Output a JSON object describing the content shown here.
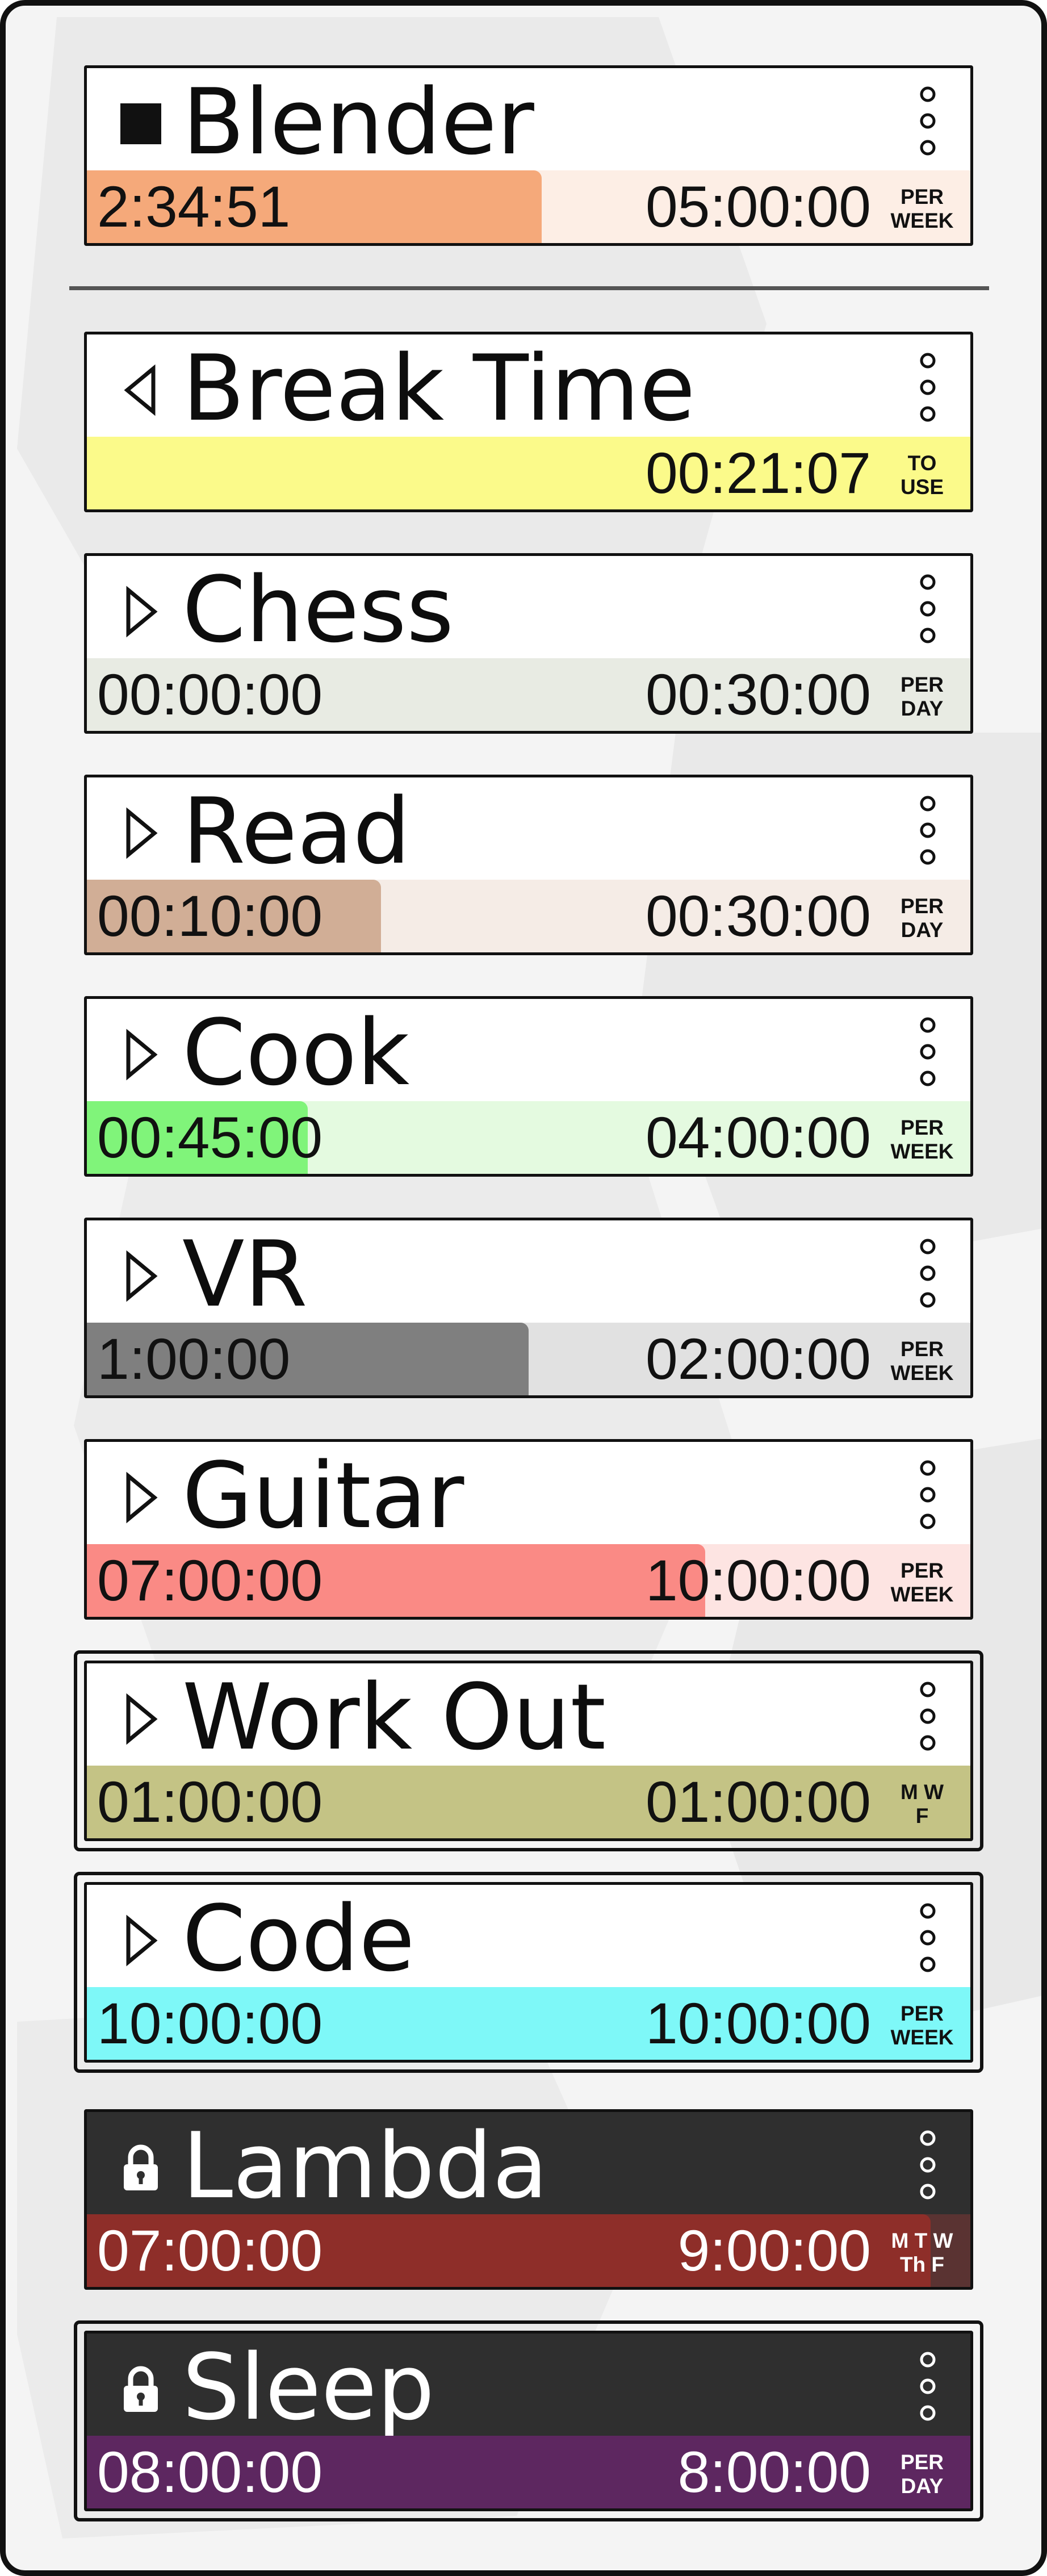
{
  "app": {
    "colors": {
      "page_background": "#f4f4f4",
      "card_border": "#111111",
      "dark_card": "#2f2f2f"
    }
  },
  "activities": [
    {
      "id": "blender",
      "name": "Blender",
      "status_icon": "stop-icon",
      "elapsed": "2:34:51",
      "target": "05:00:00",
      "unit": [
        "PER",
        "WEEK"
      ],
      "progress": 0.515,
      "fill_color": "#f5a97a",
      "track_color": "#fdeee5"
    },
    {
      "id": "break-time",
      "name": "Break Time",
      "status_icon": "play-reverse-icon",
      "elapsed": "",
      "target": "00:21:07",
      "unit": [
        "TO",
        "USE"
      ],
      "progress": 0,
      "fill_color": "#fbfa8a",
      "track_color": "#fbfa8a"
    },
    {
      "id": "chess",
      "name": "Chess",
      "status_icon": "play-icon",
      "elapsed": "00:00:00",
      "target": "00:30:00",
      "unit": [
        "PER",
        "DAY"
      ],
      "progress": 0,
      "fill_color": "#b9c4ad",
      "track_color": "#e8ebe3"
    },
    {
      "id": "read",
      "name": "Read",
      "status_icon": "play-icon",
      "elapsed": "00:10:00",
      "target": "00:30:00",
      "unit": [
        "PER",
        "DAY"
      ],
      "progress": 0.333,
      "fill_color": "#d1ae96",
      "track_color": "#f5ece6"
    },
    {
      "id": "cook",
      "name": "Cook",
      "status_icon": "play-icon",
      "elapsed": "00:45:00",
      "target": "04:00:00",
      "unit": [
        "PER",
        "WEEK"
      ],
      "progress": 0.25,
      "fill_color": "#80f47a",
      "track_color": "#e4fae0"
    },
    {
      "id": "vr",
      "name": "VR",
      "status_icon": "play-icon",
      "elapsed": "1:00:00",
      "target": "02:00:00",
      "unit": [
        "PER",
        "WEEK"
      ],
      "progress": 0.5,
      "fill_color": "#7f7f7f",
      "track_color": "#e1e1e1"
    },
    {
      "id": "guitar",
      "name": "Guitar",
      "status_icon": "play-icon",
      "elapsed": "07:00:00",
      "target": "10:00:00",
      "unit": [
        "PER",
        "WEEK"
      ],
      "progress": 0.7,
      "fill_color": "#fa8a85",
      "track_color": "#fde4e2"
    },
    {
      "id": "work-out",
      "name": "Work Out",
      "status_icon": "play-icon",
      "elapsed": "01:00:00",
      "target": "01:00:00",
      "unit": [
        "M W",
        "F"
      ],
      "progress": 1,
      "fill_color": "#c4c385",
      "track_color": "#c4c385"
    },
    {
      "id": "code",
      "name": "Code",
      "status_icon": "play-icon",
      "elapsed": "10:00:00",
      "target": "10:00:00",
      "unit": [
        "PER",
        "WEEK"
      ],
      "progress": 1,
      "fill_color": "#7ef8f8",
      "track_color": "#7ef8f8"
    },
    {
      "id": "lambda",
      "name": "Lambda",
      "status_icon": "lock-icon",
      "elapsed": "07:00:00",
      "target": "9:00:00",
      "unit": [
        "M T W",
        "Th F"
      ],
      "progress": 0.955,
      "fill_color": "#8e2e29",
      "track_color": "#5a3332"
    },
    {
      "id": "sleep",
      "name": "Sleep",
      "status_icon": "lock-icon",
      "elapsed": "08:00:00",
      "target": "8:00:00",
      "unit": [
        "PER",
        "DAY"
      ],
      "progress": 1,
      "fill_color": "#5d2760",
      "track_color": "#5d2760"
    }
  ]
}
